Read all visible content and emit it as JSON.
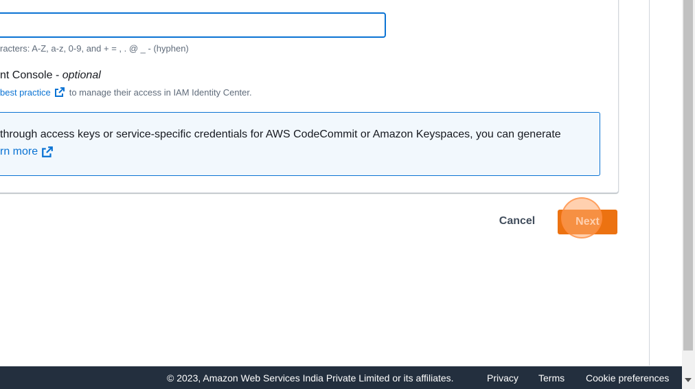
{
  "form": {
    "username_value": "",
    "username_hint": "racters: A-Z, a-z, 0-9, and + = , . @ _ - (hyphen)",
    "console_label": "nt Console - ",
    "console_label_optional": "optional",
    "console_desc_link": "best practice",
    "console_desc_text": "to manage their access in IAM Identity Center."
  },
  "info": {
    "text": "through access keys or service-specific credentials for AWS CodeCommit or Amazon Keyspaces, you can generate",
    "link": "rn more"
  },
  "actions": {
    "cancel_label": "Cancel",
    "next_label": "Next"
  },
  "footer": {
    "copyright": "© 2023, Amazon Web Services India Private Limited or its affiliates.",
    "privacy": "Privacy",
    "terms": "Terms",
    "cookie": "Cookie preferences"
  },
  "colors": {
    "primary": "#ec7211",
    "link": "#0972d3",
    "footer_bg": "#232f3e",
    "info_bg": "#f2f8fd"
  }
}
